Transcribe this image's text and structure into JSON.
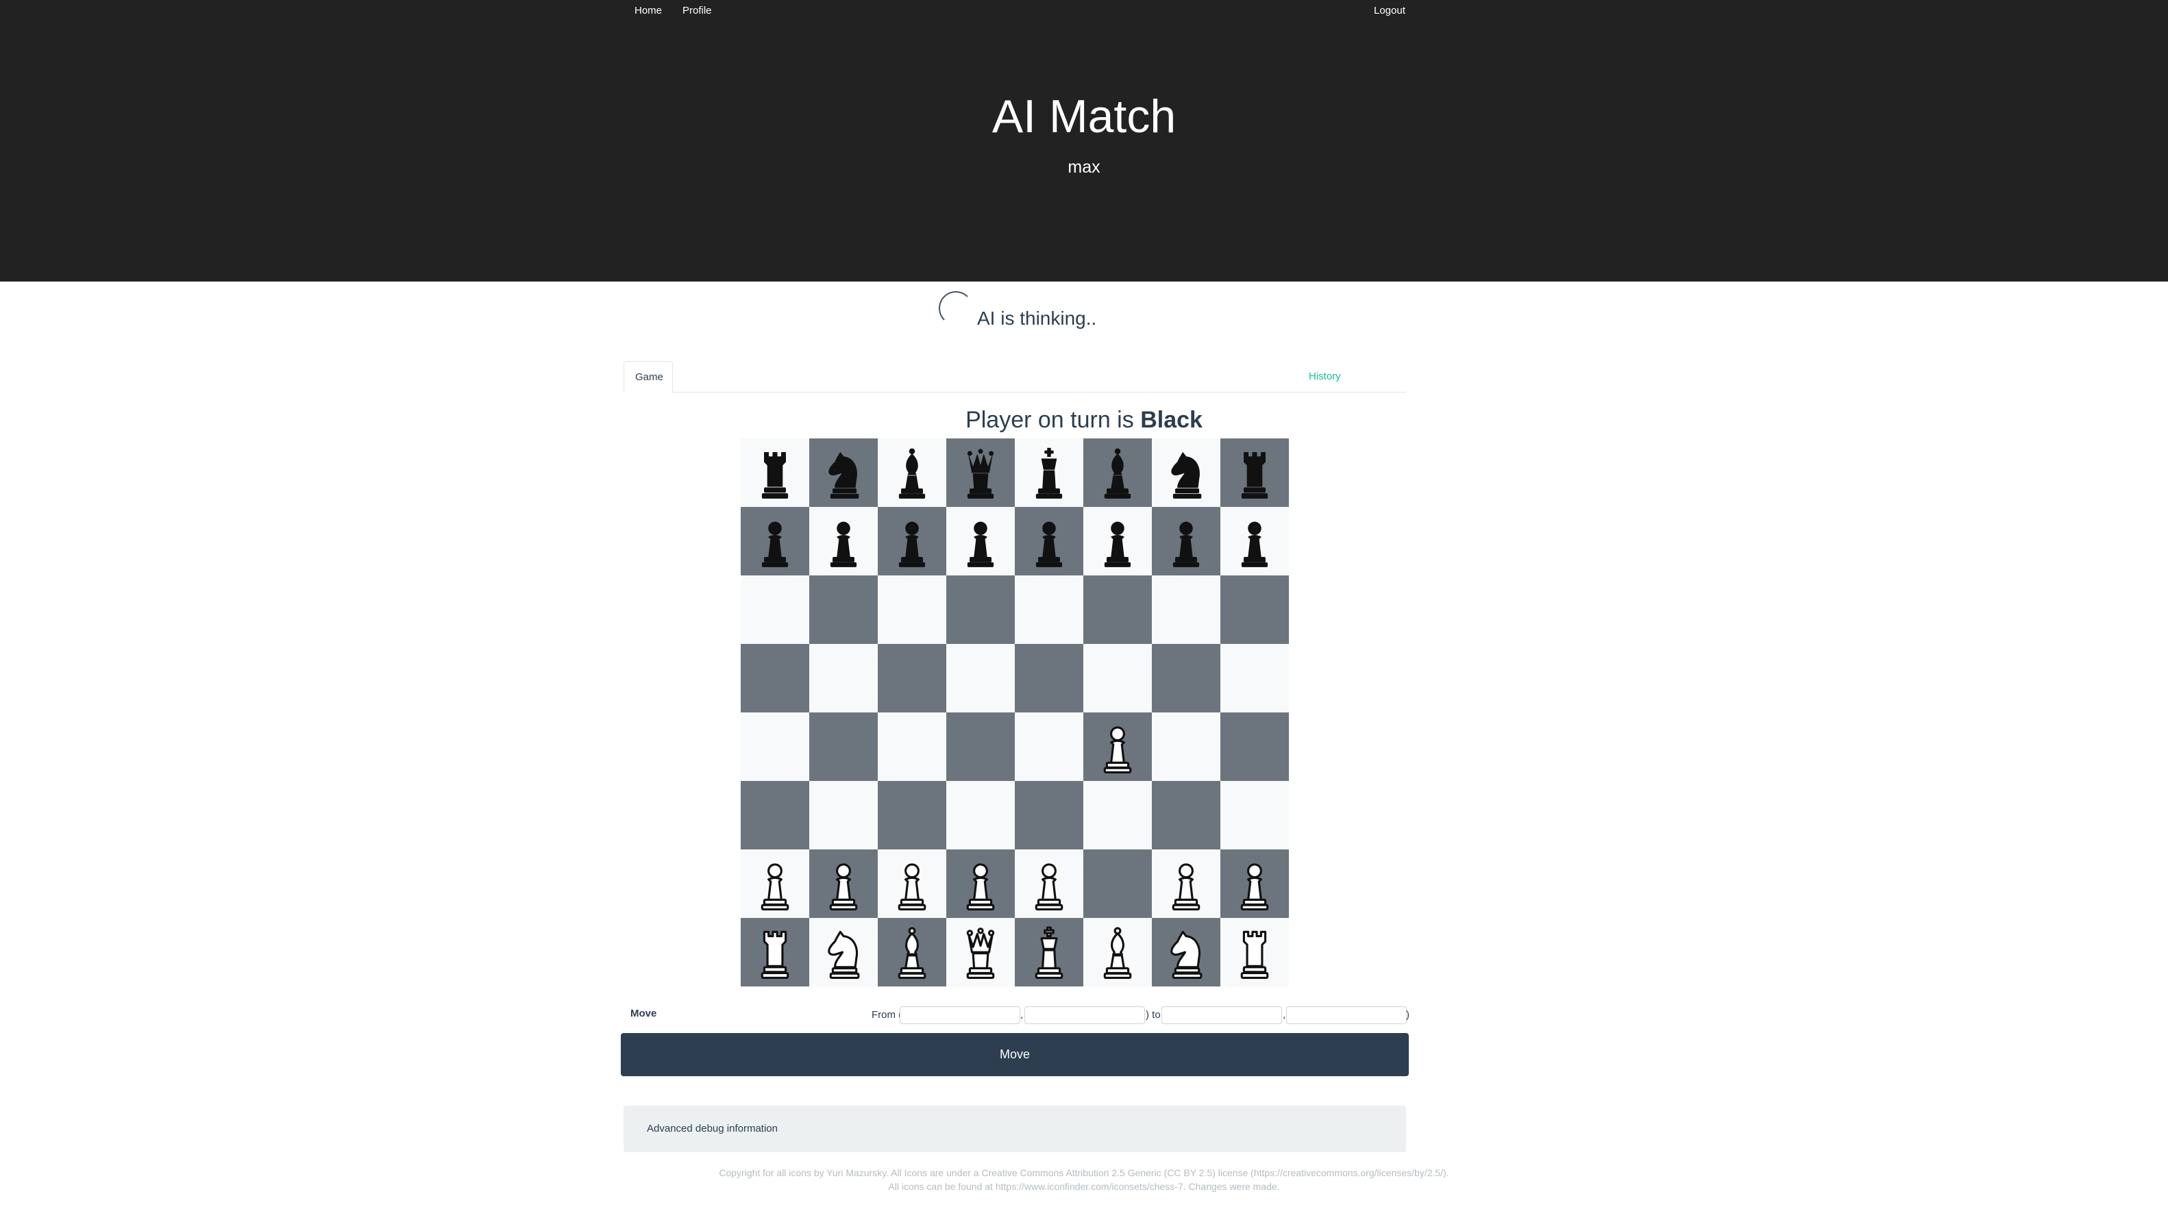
{
  "nav": {
    "home": "Home",
    "profile": "Profile",
    "logout": "Logout"
  },
  "hero": {
    "title": "AI Match",
    "subtitle": "max"
  },
  "status": {
    "text": "AI is thinking.."
  },
  "tabs": [
    {
      "label": "Game",
      "active": true
    },
    {
      "label": "History",
      "active": false
    }
  ],
  "turn": {
    "prefix": "Player on turn is ",
    "player": "Black"
  },
  "board": {
    "rows": [
      [
        "black-rook",
        "black-knight",
        "black-bishop",
        "black-queen",
        "black-king",
        "black-bishop",
        "black-knight",
        "black-rook"
      ],
      [
        "black-pawn",
        "black-pawn",
        "black-pawn",
        "black-pawn",
        "black-pawn",
        "black-pawn",
        "black-pawn",
        "black-pawn"
      ],
      [
        "",
        "",
        "",
        "",
        "",
        "",
        "",
        ""
      ],
      [
        "",
        "",
        "",
        "",
        "",
        "",
        "",
        ""
      ],
      [
        "",
        "",
        "",
        "",
        "",
        "white-pawn",
        "",
        ""
      ],
      [
        "",
        "",
        "",
        "",
        "",
        "",
        "",
        ""
      ],
      [
        "white-pawn",
        "white-pawn",
        "white-pawn",
        "white-pawn",
        "white-pawn",
        "",
        "white-pawn",
        "white-pawn"
      ],
      [
        "white-rook",
        "white-knight",
        "white-bishop",
        "white-queen",
        "white-king",
        "white-bishop",
        "white-knight",
        "white-rook"
      ]
    ]
  },
  "move_form": {
    "label": "Move",
    "from_text": "From (",
    "sep1": ",",
    "mid_text": ") to (",
    "sep2": ",",
    "end_text": ")",
    "from_x": "",
    "from_y": "",
    "to_x": "",
    "to_y": "",
    "button_label": "Move"
  },
  "debug": {
    "label": "Advanced debug information"
  },
  "footer": {
    "line1": "Copyright for all icons by Yuri Mazursky. All Icons are under a Creative Commons Attribution 2.5 Generic (CC BY 2.5) license (https://creativecommons.org/licenses/by/2.5/).",
    "line2": "All icons can be found at https://www.iconfinder.com/iconsets/chess-7. Changes were made."
  },
  "colors": {
    "header_bg": "#222222",
    "primary": "#2c3e50",
    "accent": "#18bc9c",
    "square_light": "#f8f9fa",
    "square_dark": "#6c757d"
  }
}
